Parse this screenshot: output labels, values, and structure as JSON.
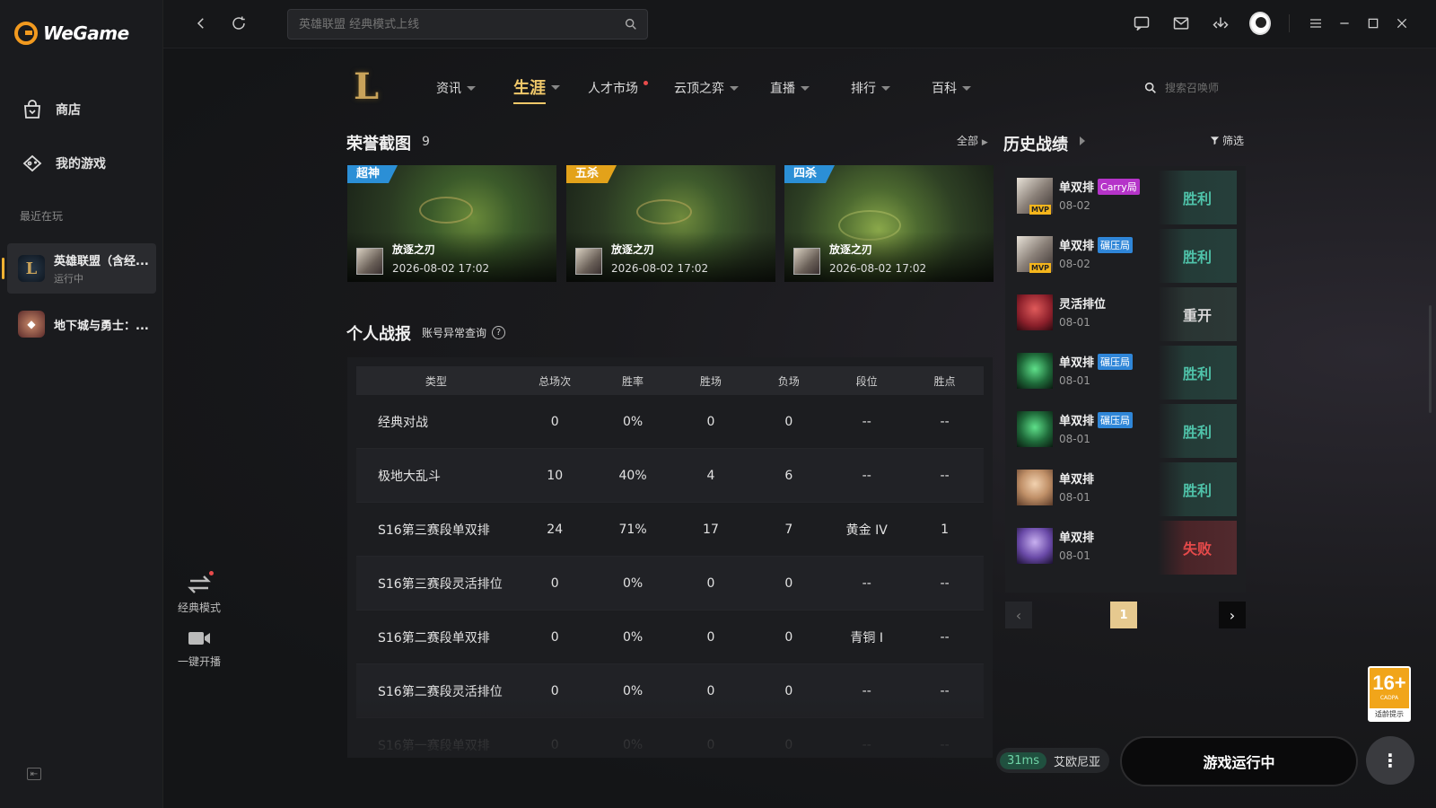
{
  "app": {
    "brand": "WeGame"
  },
  "sidebar": {
    "store_label": "商店",
    "mygames_label": "我的游戏",
    "recent_label": "最近在玩",
    "games": [
      {
        "title": "英雄联盟（含经...",
        "status": "运行中"
      },
      {
        "title": "地下城与勇士：...",
        "status": ""
      }
    ]
  },
  "search": {
    "placeholder": "英雄联盟 经典模式上线"
  },
  "game_nav": {
    "items": [
      "资讯",
      "生涯",
      "人才市场",
      "云顶之弈",
      "直播",
      "排行",
      "百科"
    ],
    "summoner_search_placeholder": "搜索召唤师"
  },
  "honor": {
    "title": "荣誉截图",
    "count": "9",
    "see_all": "全部",
    "shots": [
      {
        "tag": "超神",
        "champion": "放逐之刃",
        "time": "2026-08-02 17:02",
        "tag_color": "#2b8fd6"
      },
      {
        "tag": "五杀",
        "champion": "放逐之刃",
        "time": "2026-08-02 17:02",
        "tag_color": "#e3a21a"
      },
      {
        "tag": "四杀",
        "champion": "放逐之刃",
        "time": "2026-08-02 17:02",
        "tag_color": "#2b8fd6"
      }
    ]
  },
  "stats": {
    "title": "个人战报",
    "abnormal_link": "账号异常查询",
    "headers": [
      "类型",
      "总场次",
      "胜率",
      "胜场",
      "负场",
      "段位",
      "胜点"
    ],
    "rows": [
      [
        "经典对战",
        "0",
        "0%",
        "0",
        "0",
        "--",
        "--"
      ],
      [
        "极地大乱斗",
        "10",
        "40%",
        "4",
        "6",
        "--",
        "--"
      ],
      [
        "S16第三赛段单双排",
        "24",
        "71%",
        "17",
        "7",
        "黄金 IV",
        "1"
      ],
      [
        "S16第三赛段灵活排位",
        "0",
        "0%",
        "0",
        "0",
        "--",
        "--"
      ],
      [
        "S16第二赛段单双排",
        "0",
        "0%",
        "0",
        "0",
        "青铜 I",
        "--"
      ],
      [
        "S16第二赛段灵活排位",
        "0",
        "0%",
        "0",
        "0",
        "--",
        "--"
      ],
      [
        "S16第一赛段单双排",
        "0",
        "0%",
        "0",
        "0",
        "--",
        "--"
      ]
    ]
  },
  "history": {
    "title": "历史战绩",
    "filter_label": "筛选",
    "mvp_label": "MVP",
    "matches": [
      {
        "mode": "单双排",
        "badge": "Carry局",
        "badge_type": "carry",
        "date": "08-02",
        "result": "胜利",
        "result_type": "win",
        "mvp": true
      },
      {
        "mode": "单双排",
        "badge": "碾压局",
        "badge_type": "crush",
        "date": "08-02",
        "result": "胜利",
        "result_type": "win",
        "mvp": true
      },
      {
        "mode": "灵活排位",
        "badge": "",
        "badge_type": "",
        "date": "08-01",
        "result": "重开",
        "result_type": "draw",
        "mvp": false
      },
      {
        "mode": "单双排",
        "badge": "碾压局",
        "badge_type": "crush",
        "date": "08-01",
        "result": "胜利",
        "result_type": "win",
        "mvp": false
      },
      {
        "mode": "单双排",
        "badge": "碾压局",
        "badge_type": "crush",
        "date": "08-01",
        "result": "胜利",
        "result_type": "win",
        "mvp": false
      },
      {
        "mode": "单双排",
        "badge": "",
        "badge_type": "",
        "date": "08-01",
        "result": "胜利",
        "result_type": "win",
        "mvp": false
      },
      {
        "mode": "单双排",
        "badge": "",
        "badge_type": "",
        "date": "08-01",
        "result": "失败",
        "result_type": "loss",
        "mvp": false
      }
    ],
    "page": "1"
  },
  "tools": {
    "classic_mode": "经典模式",
    "one_click_stream": "一键开播"
  },
  "bottom": {
    "ping": "31ms",
    "server": "艾欧尼亚",
    "run_button": "游戏运行中"
  },
  "age_rating": {
    "number": "16+",
    "sub": "CADPA",
    "hint": "适龄提示"
  }
}
